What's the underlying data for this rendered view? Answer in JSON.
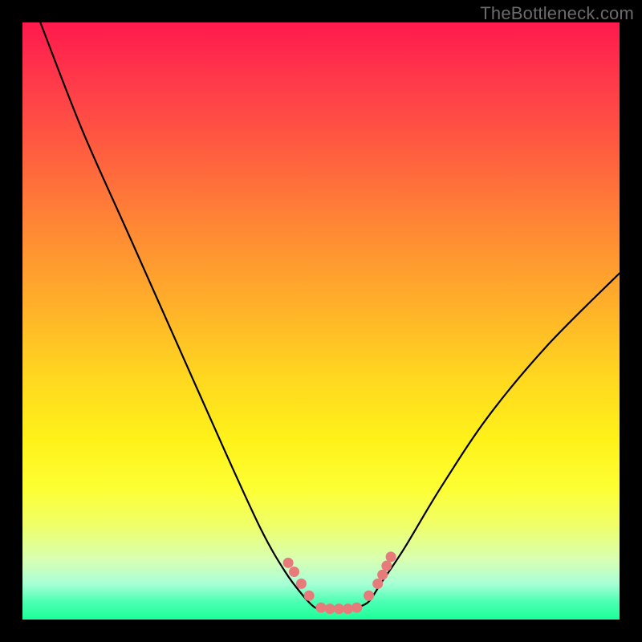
{
  "watermark": "TheBottleneck.com",
  "chart_data": {
    "type": "line",
    "title": "",
    "xlabel": "",
    "ylabel": "",
    "xlim": [
      0,
      100
    ],
    "ylim": [
      0,
      100
    ],
    "grid": false,
    "legend": false,
    "series": [
      {
        "name": "curve-left",
        "x": [
          3,
          10,
          18,
          26,
          34,
          40,
          44,
          47,
          49,
          50
        ],
        "y": [
          100,
          82,
          64,
          46,
          28,
          15,
          8,
          4,
          2,
          2
        ]
      },
      {
        "name": "curve-right",
        "x": [
          56,
          58,
          60,
          64,
          70,
          78,
          88,
          100
        ],
        "y": [
          2,
          3,
          6,
          12,
          22,
          34,
          46,
          58
        ]
      },
      {
        "name": "plateau",
        "x": [
          50,
          56
        ],
        "y": [
          2,
          2
        ]
      }
    ],
    "markers": [
      {
        "name": "left-dot-1",
        "x": 44.5,
        "y": 9.5
      },
      {
        "name": "left-dot-2",
        "x": 45.5,
        "y": 8.0
      },
      {
        "name": "left-dot-3",
        "x": 46.7,
        "y": 6.0
      },
      {
        "name": "left-dot-4",
        "x": 48.0,
        "y": 4.0
      },
      {
        "name": "plateau-dot-1",
        "x": 50.0,
        "y": 2.0
      },
      {
        "name": "plateau-dot-2",
        "x": 51.5,
        "y": 1.8
      },
      {
        "name": "plateau-dot-3",
        "x": 53.0,
        "y": 1.8
      },
      {
        "name": "plateau-dot-4",
        "x": 54.5,
        "y": 1.8
      },
      {
        "name": "plateau-dot-5",
        "x": 56.0,
        "y": 2.0
      },
      {
        "name": "right-dot-1",
        "x": 58.0,
        "y": 4.0
      },
      {
        "name": "right-cluster-1",
        "x": 59.5,
        "y": 6.0
      },
      {
        "name": "right-cluster-2",
        "x": 60.3,
        "y": 7.5
      },
      {
        "name": "right-cluster-3",
        "x": 61.0,
        "y": 9.0
      },
      {
        "name": "right-cluster-4",
        "x": 61.7,
        "y": 10.5
      }
    ],
    "marker_color": "#e77b7b",
    "curve_color": "#000000",
    "background_gradient": [
      "#ff1a4d",
      "#ffd91f",
      "#1cff99"
    ]
  }
}
